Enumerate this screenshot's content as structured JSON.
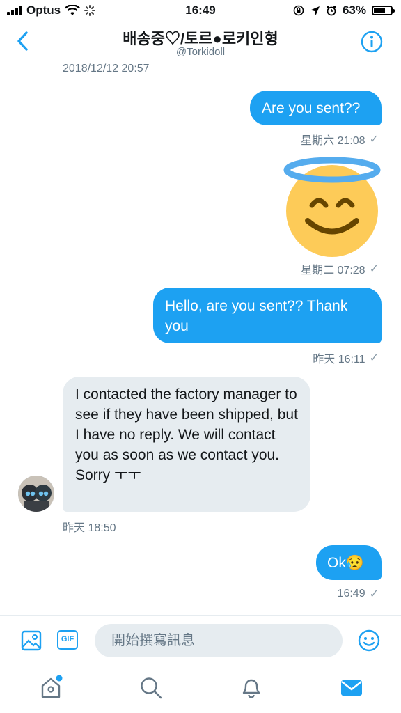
{
  "status_bar": {
    "carrier": "Optus",
    "time": "16:49",
    "battery": "63%",
    "battery_level": 0.63
  },
  "header": {
    "title": "배송중♡/토르●로키인형",
    "handle": "@Torkidoll",
    "back_icon": "chevron-left-icon",
    "info_icon": "info-icon"
  },
  "messages": {
    "top_timestamp": "2018/12/12 20:57",
    "m1": {
      "text": "Are you sent??",
      "time": "星期六 21:08",
      "status": "✓"
    },
    "m2": {
      "emoji": "smiling-face-with-halo",
      "time": "星期二 07:28",
      "status": "✓"
    },
    "m3": {
      "text": "Hello, are you sent?? Thank you",
      "time": "昨天 16:11",
      "status": "✓"
    },
    "m4": {
      "text": "I contacted the factory manager to see if they have been shipped, but I have no reply. We will contact you as soon as we contact you. Sorry ㅜㅜ",
      "time": "昨天 18:50"
    },
    "m5": {
      "text": "Ok😥",
      "time": "16:49",
      "status": "✓"
    }
  },
  "composer": {
    "placeholder": "開始撰寫訊息",
    "gif_label": "GIF"
  },
  "tabbar": {
    "items": [
      "home-icon",
      "search-icon",
      "notifications-icon",
      "messages-icon"
    ]
  },
  "colors": {
    "accent": "#1da1f2",
    "incoming_bubble": "#e6ecf0",
    "muted_text": "#657786"
  }
}
